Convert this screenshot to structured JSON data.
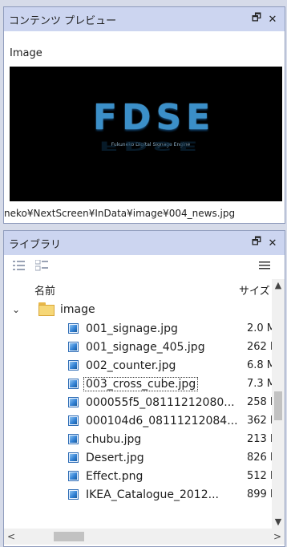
{
  "preview_panel": {
    "title": "コンテンツ プレビュー",
    "restore_icon": "🗗",
    "close_icon": "✕",
    "label": "Image",
    "logo_text": "FDSE",
    "logo_subtitle": "Fukuneko Digital Signage Engine",
    "path": "neko¥NextScreen¥InData¥image¥004_news.jpg"
  },
  "library_panel": {
    "title": "ライブラリ",
    "restore_icon": "🗗",
    "close_icon": "✕",
    "columns": {
      "name": "名前",
      "size": "サイズ"
    },
    "folder": {
      "name": "image"
    },
    "files": [
      {
        "name": "001_signage.jpg",
        "size": "2.0 M"
      },
      {
        "name": "001_signage_405.jpg",
        "size": "262 k"
      },
      {
        "name": "002_counter.jpg",
        "size": "6.8 M"
      },
      {
        "name": "003_cross_cube.jpg",
        "size": "7.3 M"
      },
      {
        "name": "000055f5_08111212080...",
        "size": "258 k"
      },
      {
        "name": "000104d6_08111212084...",
        "size": "362 k"
      },
      {
        "name": "chubu.jpg",
        "size": "213 k"
      },
      {
        "name": "Desert.jpg",
        "size": "826 k"
      },
      {
        "name": "Effect.png",
        "size": "512 k"
      },
      {
        "name": "IKEA_Catalogue_2012...",
        "size": "899 k"
      }
    ]
  }
}
